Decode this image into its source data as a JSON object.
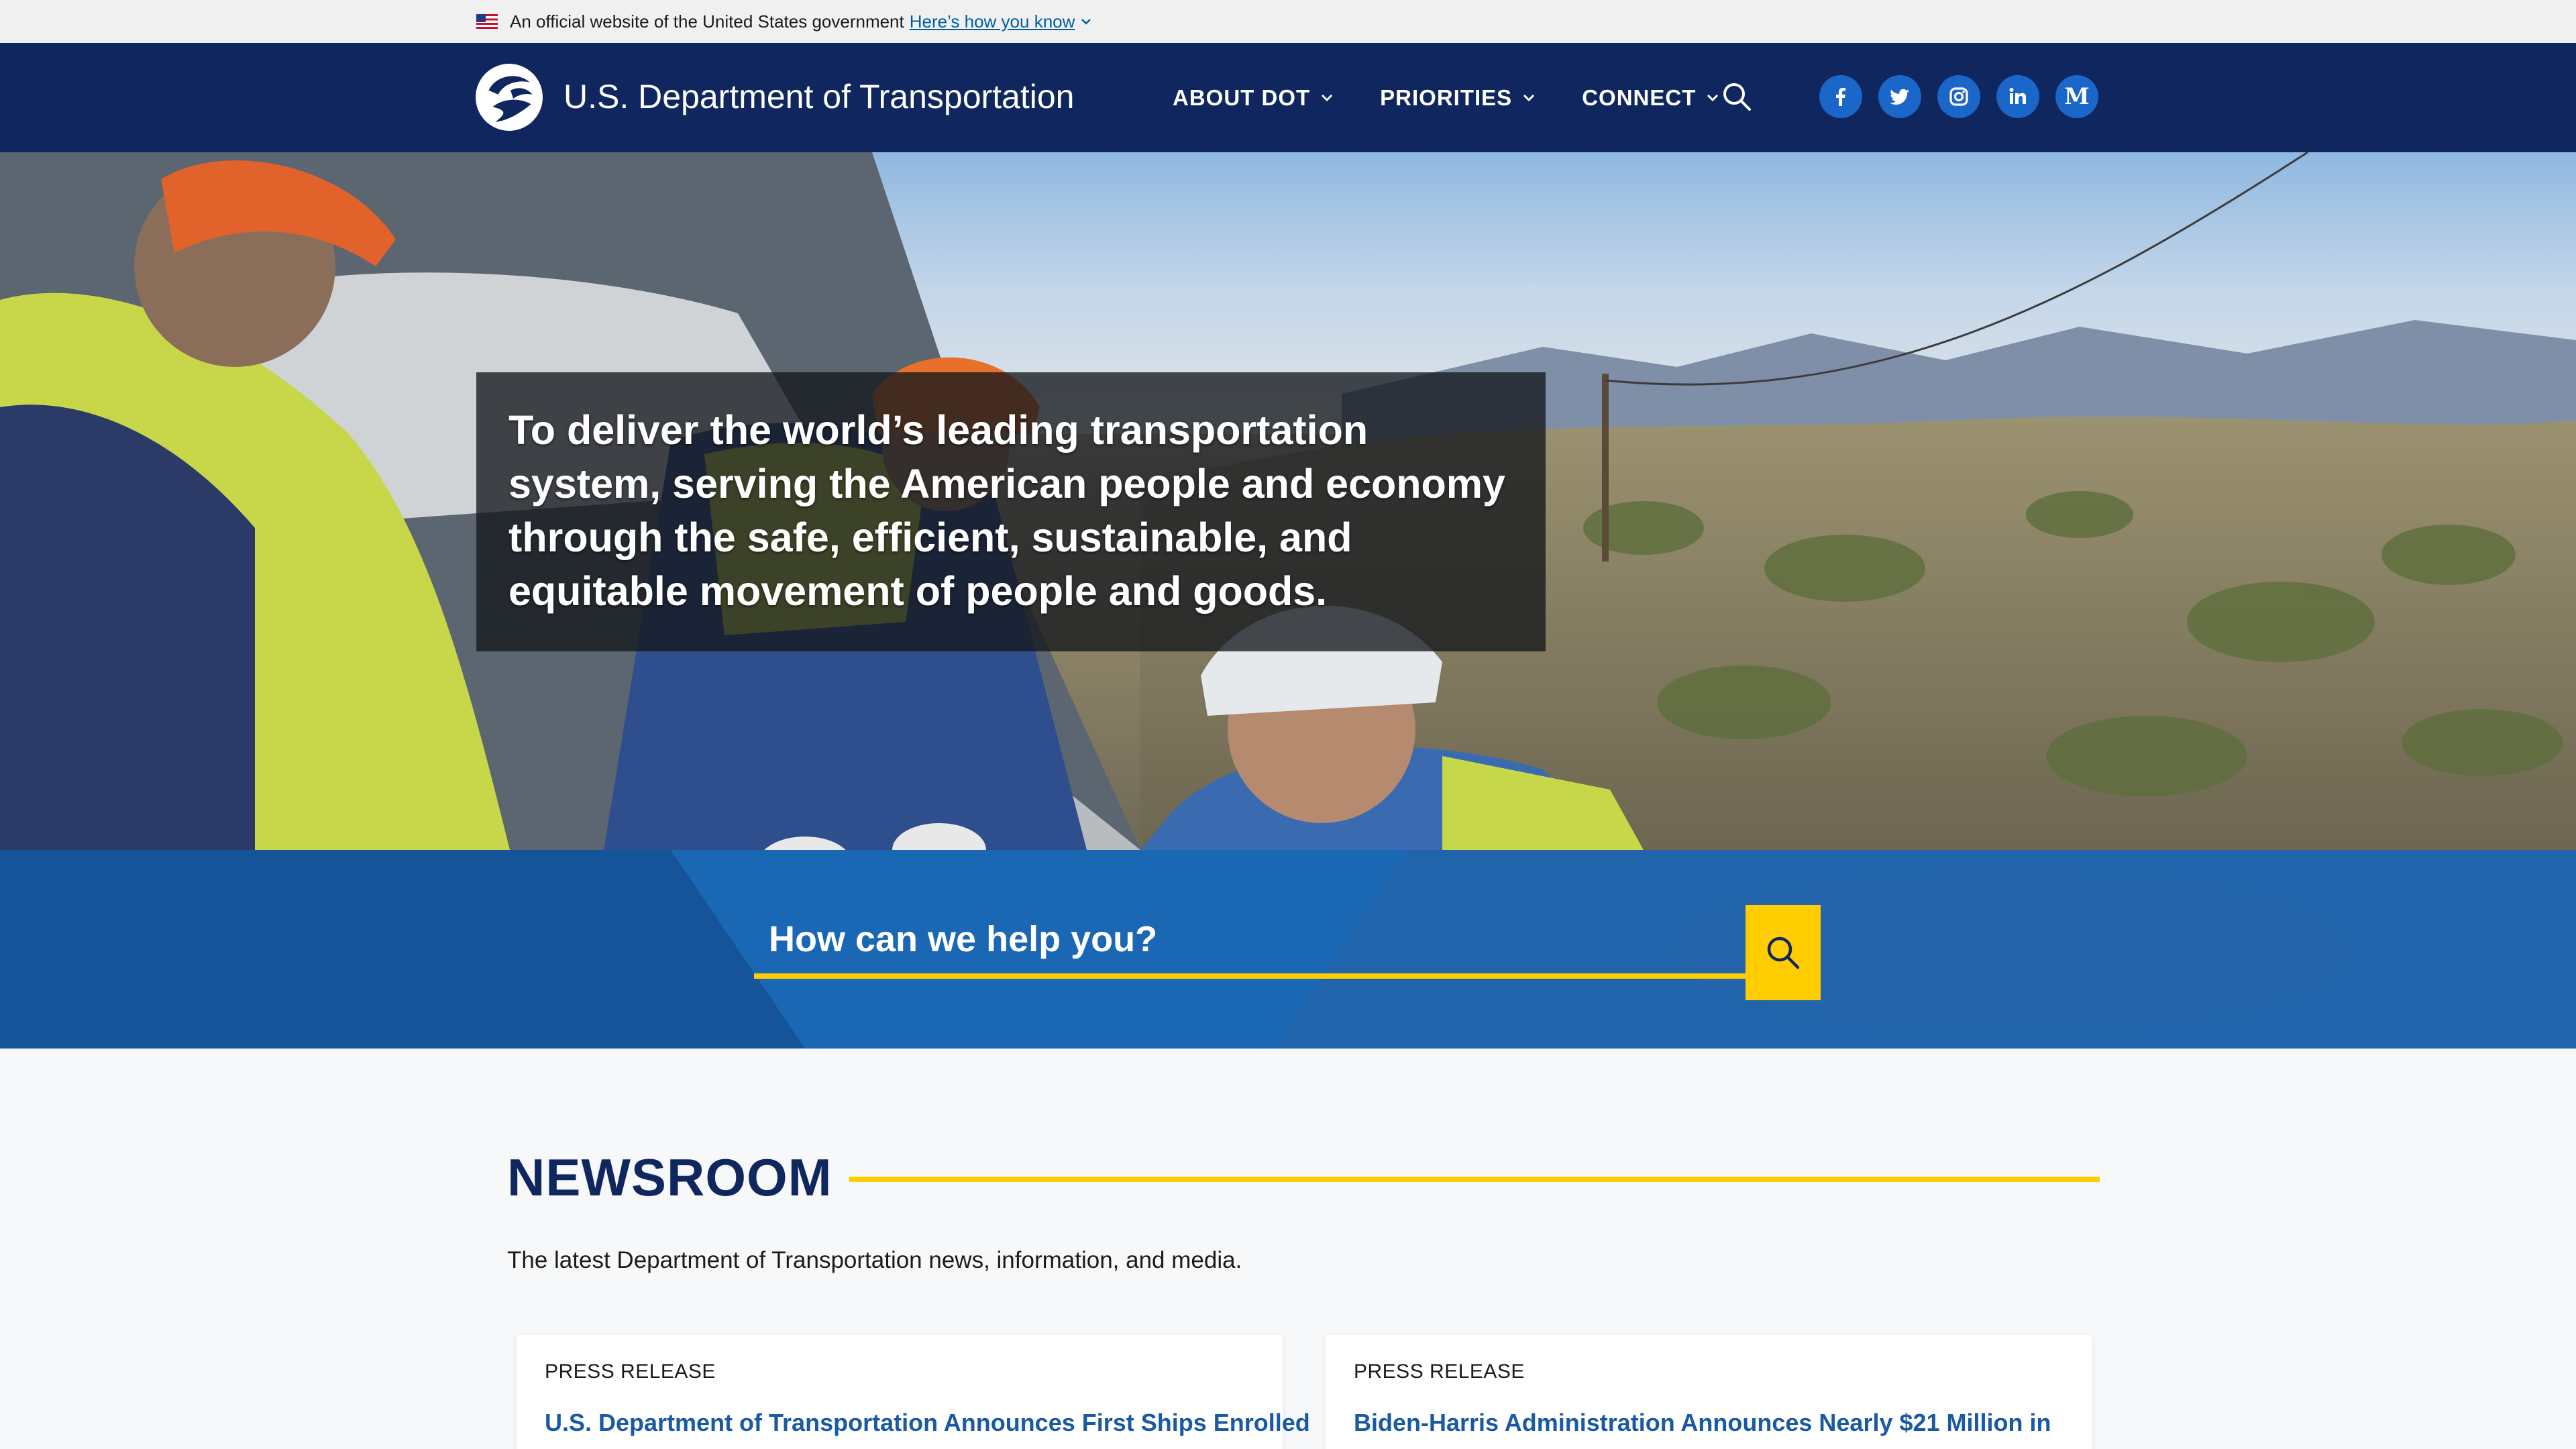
{
  "gov_banner": {
    "text": "An official website of the United States government",
    "link": "Here’s how you know"
  },
  "header": {
    "site_title": "U.S. Department of Transportation",
    "nav": [
      {
        "label": "ABOUT DOT"
      },
      {
        "label": "PRIORITIES"
      },
      {
        "label": "CONNECT"
      }
    ],
    "social": [
      {
        "icon": "facebook-icon"
      },
      {
        "icon": "twitter-icon"
      },
      {
        "icon": "instagram-icon"
      },
      {
        "icon": "linkedin-icon"
      },
      {
        "icon": "medium-icon",
        "glyph": "M"
      }
    ]
  },
  "hero": {
    "mission": "To deliver the world’s leading transportation system, serving the American people and economy through the safe, efficient, sustainable, and equitable movement of people and goods."
  },
  "search": {
    "placeholder": "How can we help you?"
  },
  "newsroom": {
    "title": "NEWSROOM",
    "subtitle": "The latest Department of Transportation news, information, and media.",
    "cards": [
      {
        "type": "PRESS RELEASE",
        "headline": "U.S. Department of Transportation Announces First Ships Enrolled"
      },
      {
        "type": "PRESS RELEASE",
        "headline": "Biden-Harris Administration Announces Nearly $21 Million in"
      }
    ]
  },
  "colors": {
    "navy": "#10265f",
    "accent_yellow": "#ffcd00",
    "search_blue": "#1a68b3",
    "link_blue": "#1a5aa3",
    "social_blue": "#1b66c9"
  }
}
